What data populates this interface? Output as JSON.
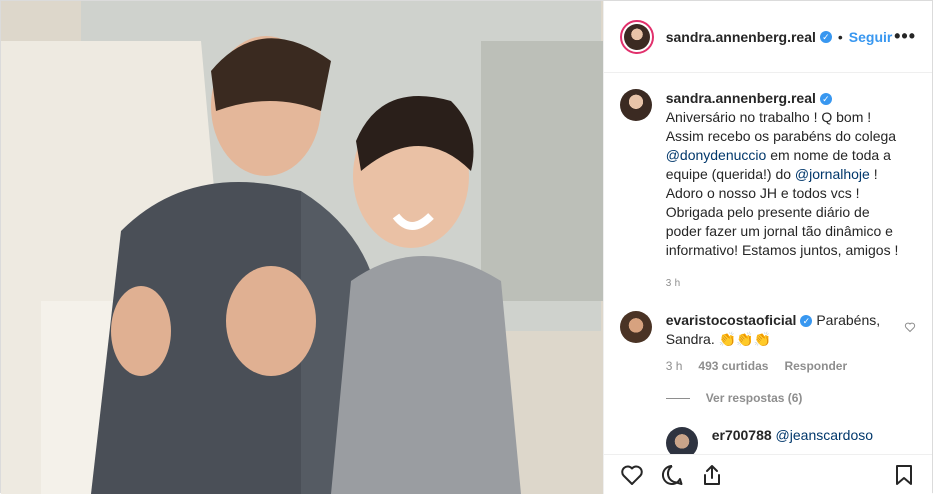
{
  "post": {
    "username": "sandra.annenberg.real",
    "follow_label": "Seguir",
    "more_label": "•••",
    "caption_text_1": " Aniversário no trabalho ! Q bom ! Assim recebo os parabéns do colega ",
    "caption_mention_1": "@donydenuccio",
    "caption_text_2": " em nome de toda a equipe (querida!) do ",
    "caption_mention_2": "@jornalhoje",
    "caption_text_3": " ! Adoro o nosso JH e todos vcs ! Obrigada pelo presente diário de poder fazer um jornal tão dinâmico e informativo! Estamos juntos, amigos !",
    "caption_time": "3 h"
  },
  "comment": {
    "username": "evaristocostaoficial",
    "text": " Parabéns, Sandra. 👏👏👏",
    "time": "3 h",
    "likes": "493 curtidas",
    "reply_label": "Responder",
    "view_replies": "Ver respostas (6)"
  },
  "reply": {
    "username": "er700788",
    "mention": "@jeanscardoso"
  },
  "colors": {
    "accent": "#3897f0",
    "mention": "#00376b",
    "muted": "#8e8e8e"
  },
  "icons": [
    "heart-icon",
    "comment-icon",
    "share-icon",
    "bookmark-icon",
    "verified-icon"
  ]
}
